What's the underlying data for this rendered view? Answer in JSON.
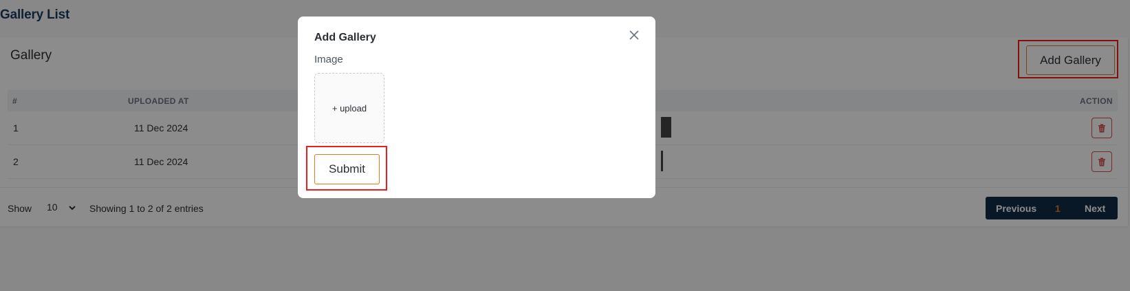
{
  "page": {
    "title": "Gallery List"
  },
  "card": {
    "title": "Gallery",
    "add_button_label": "Add Gallery",
    "columns": {
      "index": "#",
      "uploaded_at": "UPLOADED AT",
      "action": "ACTION"
    },
    "rows": [
      {
        "index": "1",
        "uploaded_at": "11 Dec 2024"
      },
      {
        "index": "2",
        "uploaded_at": "11 Dec 2024"
      }
    ]
  },
  "footer": {
    "show_label": "Show",
    "page_size": "10",
    "entries_text": "Showing 1 to 2 of 2 entries",
    "previous_label": "Previous",
    "current_page": "1",
    "next_label": "Next"
  },
  "modal": {
    "title": "Add Gallery",
    "image_label": "Image",
    "upload_label": "+ upload",
    "submit_label": "Submit"
  },
  "colors": {
    "accent": "#e07a1f",
    "navy": "#0f2d47",
    "danger": "#d64b4b",
    "highlight": "#ee1c1c"
  },
  "icons": {
    "close": "close-icon",
    "delete": "trash-icon",
    "dropdown": "chevron-down-icon"
  }
}
